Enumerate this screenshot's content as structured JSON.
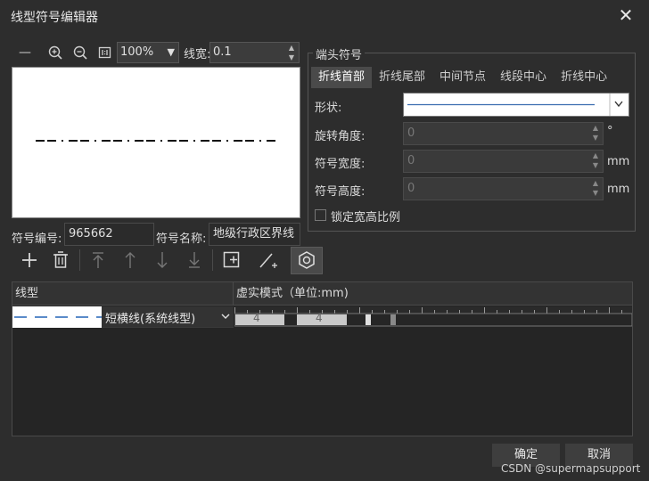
{
  "window": {
    "title": "线型符号编辑器",
    "close_glyph": "✕"
  },
  "toolbar": {
    "zoom": "100%",
    "line_width_label": "线宽:",
    "line_width": "0.1"
  },
  "symbol": {
    "id_label": "符号编号:",
    "id": "965662",
    "name_label": "符号名称:",
    "name": "地级行政区界线"
  },
  "endpoint": {
    "group_title": "端头符号",
    "tabs": [
      "折线首部",
      "折线尾部",
      "中间节点",
      "线段中心",
      "折线中心"
    ],
    "active_tab": 0,
    "shape_label": "形状:",
    "rotation_label": "旋转角度:",
    "rotation_value": "0",
    "rotation_unit": "°",
    "width_label": "符号宽度:",
    "width_value": "0",
    "width_unit": "mm",
    "height_label": "符号高度:",
    "height_value": "0",
    "height_unit": "mm",
    "lock_ratio_label": "锁定宽高比例",
    "lock_ratio_checked": false
  },
  "table": {
    "headers": [
      "线型",
      "虚实模式（单位:mm)"
    ],
    "rows": [
      {
        "type_name": "短横线(系统线型)",
        "dash_labels": [
          "4",
          "4"
        ]
      }
    ]
  },
  "buttons": {
    "ok": "确定",
    "cancel": "取消"
  },
  "watermark": "CSDN @supermapsupport"
}
